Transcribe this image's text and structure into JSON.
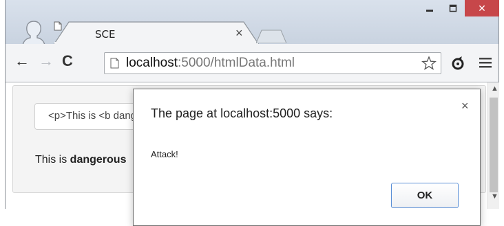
{
  "browser": {
    "tab": {
      "title": "SCE",
      "close_glyph": "×"
    },
    "window_controls": {
      "minimize": "–",
      "maximize": "☐",
      "close": "✕"
    },
    "toolbar": {
      "back_glyph": "←",
      "forward_glyph": "→",
      "reload_glyph": "C",
      "url_host": "localhost",
      "url_rest": ":5000/htmlData.html"
    }
  },
  "page": {
    "input_value": "<p>This is <b dangerous</b> text</p>",
    "rendered_prefix": "This is ",
    "rendered_bold": "dangerous"
  },
  "scrollbar": {
    "up": "▲",
    "down": "▼"
  },
  "dialog": {
    "title": "The page at localhost:5000 says:",
    "close_glyph": "×",
    "message": "Attack!",
    "ok_label": "OK"
  },
  "colors": {
    "frame": "#cfd8e4",
    "close_button": "#c7474a",
    "ok_border": "#5a8fd6"
  },
  "icons": [
    "profile-icon",
    "page-icon",
    "star-icon",
    "extension-icon",
    "menu-icon"
  ]
}
